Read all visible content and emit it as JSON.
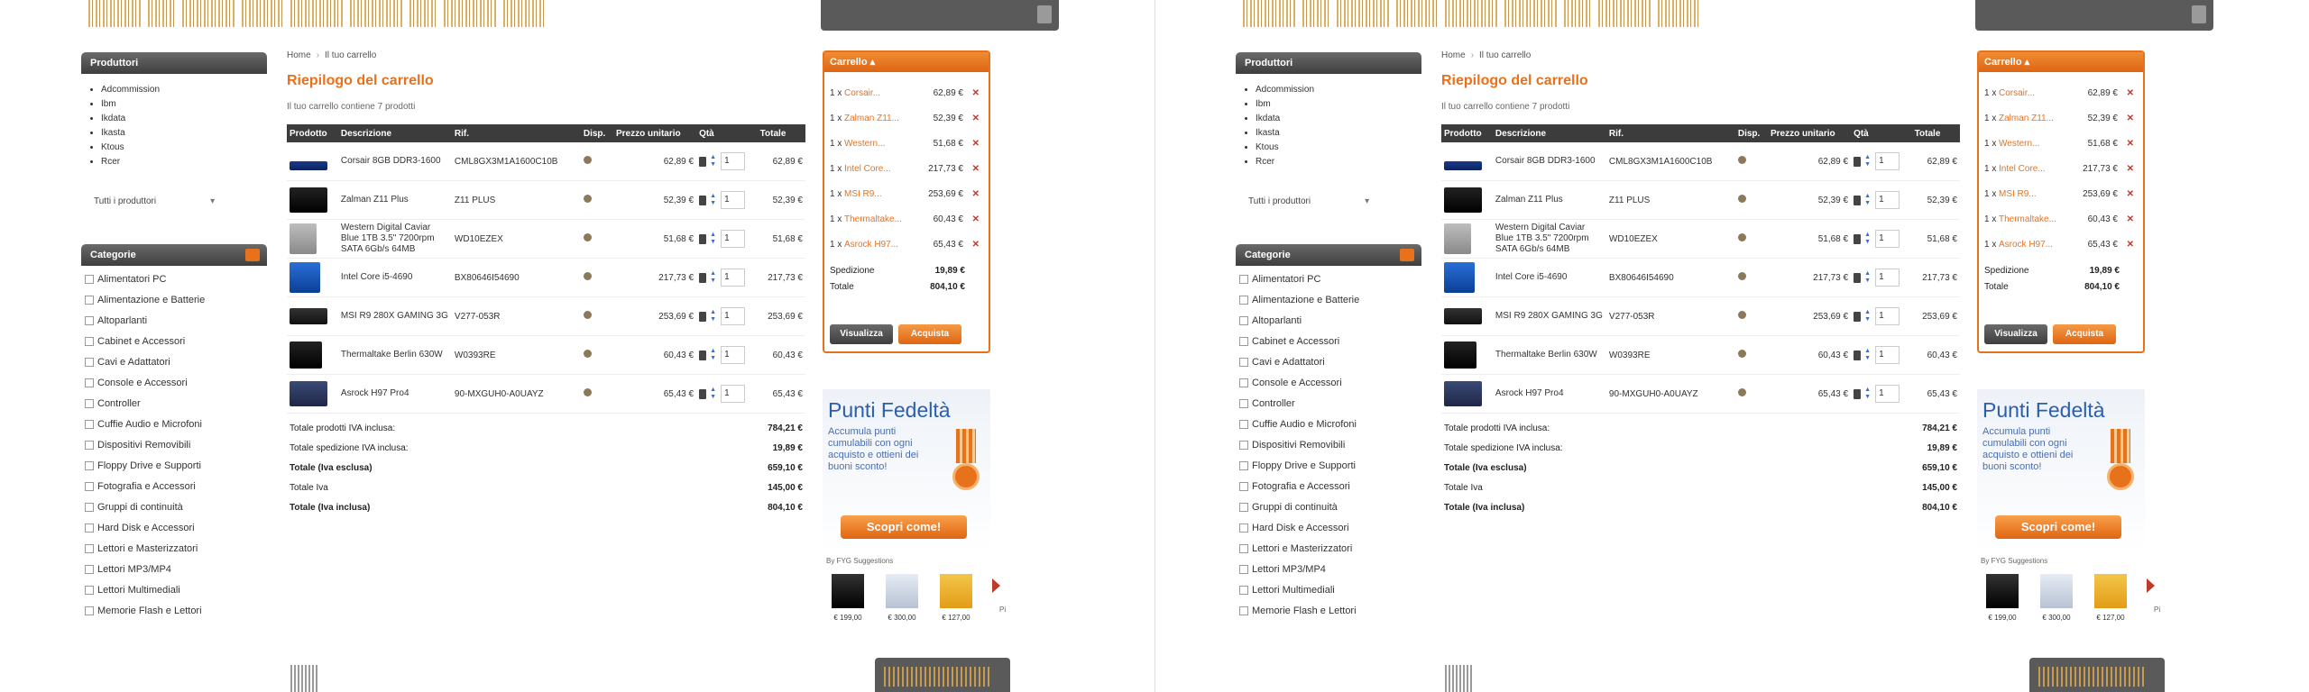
{
  "left": {
    "products_title": "Produttori",
    "products": [
      "Adcommission",
      "Ibm",
      "Ikdata",
      "Ikasta",
      "Ktous",
      "Rcer"
    ],
    "all_products": "Tutti i produttori",
    "categories_title": "Categorie",
    "categories": [
      "Alimentatori PC",
      "Alimentazione e Batterie",
      "Altoparlanti",
      "Cabinet e Accessori",
      "Cavi e Adattatori",
      "Console e Accessori",
      "Controller",
      "Cuffie Audio e Microfoni",
      "Dispositivi Removibili",
      "Floppy Drive e Supporti",
      "Fotografia e Accessori",
      "Gruppi di continuità",
      "Hard Disk e Accessori",
      "Lettori e Masterizzatori",
      "Lettori MP3/MP4",
      "Lettori Multimediali",
      "Memorie Flash e Lettori"
    ]
  },
  "main": {
    "breadcrumb_home": "Home",
    "breadcrumb_current": "Il tuo carrello",
    "title": "Riepilogo del carrello",
    "subtitle": "Il tuo carrello contiene 7 prodotti",
    "columns": [
      "Prodotto",
      "Descrizione",
      "Rif.",
      "Disp.",
      "Prezzo unitario",
      "Qtà",
      "Totale"
    ],
    "rows": [
      {
        "thumb": "t-ram",
        "desc": "Corsair 8GB DDR3-1600",
        "ref": "CML8GX3M1A1600C10B",
        "price": "62,89 €",
        "qty": "1",
        "total": "62,89 €"
      },
      {
        "thumb": "t-psu",
        "desc": "Zalman Z11 Plus",
        "ref": "Z11 PLUS",
        "price": "52,39 €",
        "qty": "1",
        "total": "52,39 €"
      },
      {
        "thumb": "t-hdd",
        "desc": "Western Digital Caviar Blue 1TB 3.5\" 7200rpm SATA 6Gb/s 64MB",
        "ref": "WD10EZEX",
        "price": "51,68 €",
        "qty": "1",
        "total": "51,68 €"
      },
      {
        "thumb": "t-cpu",
        "desc": "Intel Core i5-4690",
        "ref": "BX80646I54690",
        "price": "217,73 €",
        "qty": "1",
        "total": "217,73 €"
      },
      {
        "thumb": "t-gpu",
        "desc": "MSI R9 280X GAMING 3G",
        "ref": "V277-053R",
        "price": "253,69 €",
        "qty": "1",
        "total": "253,69 €"
      },
      {
        "thumb": "t-case",
        "desc": "Thermaltake Berlin 630W",
        "ref": "W0393RE",
        "price": "60,43 €",
        "qty": "1",
        "total": "60,43 €"
      },
      {
        "thumb": "t-mb",
        "desc": "Asrock H97 Pro4",
        "ref": "90-MXGUH0-A0UAYZ",
        "price": "65,43 €",
        "qty": "1",
        "total": "65,43 €"
      }
    ],
    "summary": [
      {
        "label": "Totale prodotti IVA inclusa:",
        "value": "784,21 €",
        "bold": false
      },
      {
        "label": "Totale spedizione IVA inclusa:",
        "value": "19,89 €",
        "bold": false
      },
      {
        "label": "Totale (Iva esclusa)",
        "value": "659,10 €",
        "bold": true
      },
      {
        "label": "Totale Iva",
        "value": "145,00 €",
        "bold": false
      },
      {
        "label": "Totale (Iva inclusa)",
        "value": "804,10 €",
        "bold": true
      }
    ]
  },
  "minicart": {
    "title": "Carrello",
    "items": [
      {
        "q": "1 x",
        "n": "Corsair...",
        "p": "62,89 €"
      },
      {
        "q": "1 x",
        "n": "Zalman Z11...",
        "p": "52,39 €"
      },
      {
        "q": "1 x",
        "n": "Western...",
        "p": "51,68 €"
      },
      {
        "q": "1 x",
        "n": "Intel Core...",
        "p": "217,73 €"
      },
      {
        "q": "1 x",
        "n": "MSI R9...",
        "p": "253,69 €"
      },
      {
        "q": "1 x",
        "n": "Thermaltake...",
        "p": "60,43 €"
      },
      {
        "q": "1 x",
        "n": "Asrock H97...",
        "p": "65,43 €"
      }
    ],
    "shipping_label": "Spedizione",
    "shipping_value": "19,89 €",
    "total_label": "Totale",
    "total_value": "804,10 €",
    "view_button": "Visualizza",
    "buy_button": "Acquista"
  },
  "loyalty": {
    "title": "Punti Fedeltà",
    "body": "Accumula punti cumulabili con ogni acquisto e ottieni dei buoni sconto!",
    "cta": "Scopri come!",
    "source": "By FYG Suggestions",
    "ads": [
      {
        "img": "img-a",
        "price": "€ 199,00"
      },
      {
        "img": "img-b",
        "price": "€ 300,00"
      },
      {
        "img": "img-c",
        "price": "€ 127,00"
      }
    ],
    "next": "Pi"
  },
  "colors": {
    "accent": "#e8721c",
    "header_dark": "#3c3c3c",
    "link_blue": "#2a5fb0"
  }
}
